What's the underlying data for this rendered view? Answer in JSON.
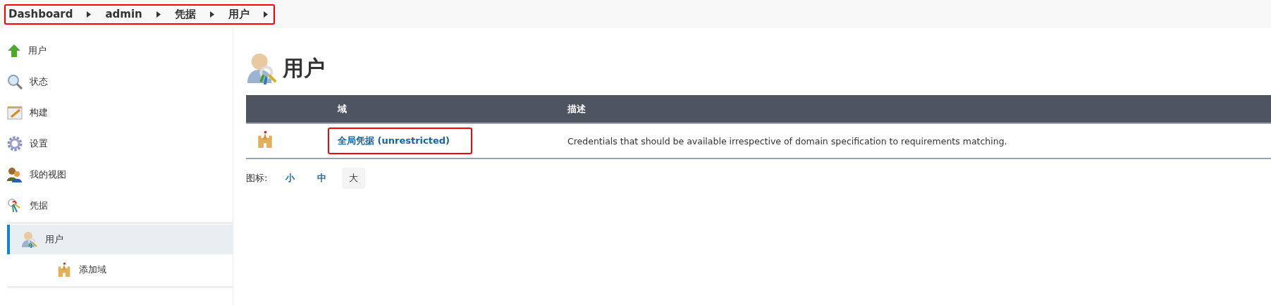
{
  "breadcrumbs": [
    "Dashboard",
    "admin",
    "凭据",
    "用户"
  ],
  "sidebar": {
    "items": [
      {
        "label": "用户",
        "selected": false
      },
      {
        "label": "状态",
        "selected": false
      },
      {
        "label": "构建",
        "selected": false
      },
      {
        "label": "设置",
        "selected": false
      },
      {
        "label": "我的视图",
        "selected": false
      },
      {
        "label": "凭据",
        "selected": false
      },
      {
        "label": "用户",
        "selected": true,
        "children": [
          {
            "label": "添加域",
            "selected": false
          }
        ]
      }
    ]
  },
  "page_title": "用户",
  "table": {
    "columns": [
      "域",
      "描述"
    ],
    "rows": [
      {
        "domain": "全局凭据 (unrestricted)",
        "description": "Credentials that should be available irrespective of domain specification to requirements matching."
      }
    ]
  },
  "icon_size": {
    "label": "图标:",
    "options": [
      {
        "label": "小",
        "selected": false
      },
      {
        "label": "中",
        "selected": false
      },
      {
        "label": "大",
        "selected": true
      }
    ]
  }
}
